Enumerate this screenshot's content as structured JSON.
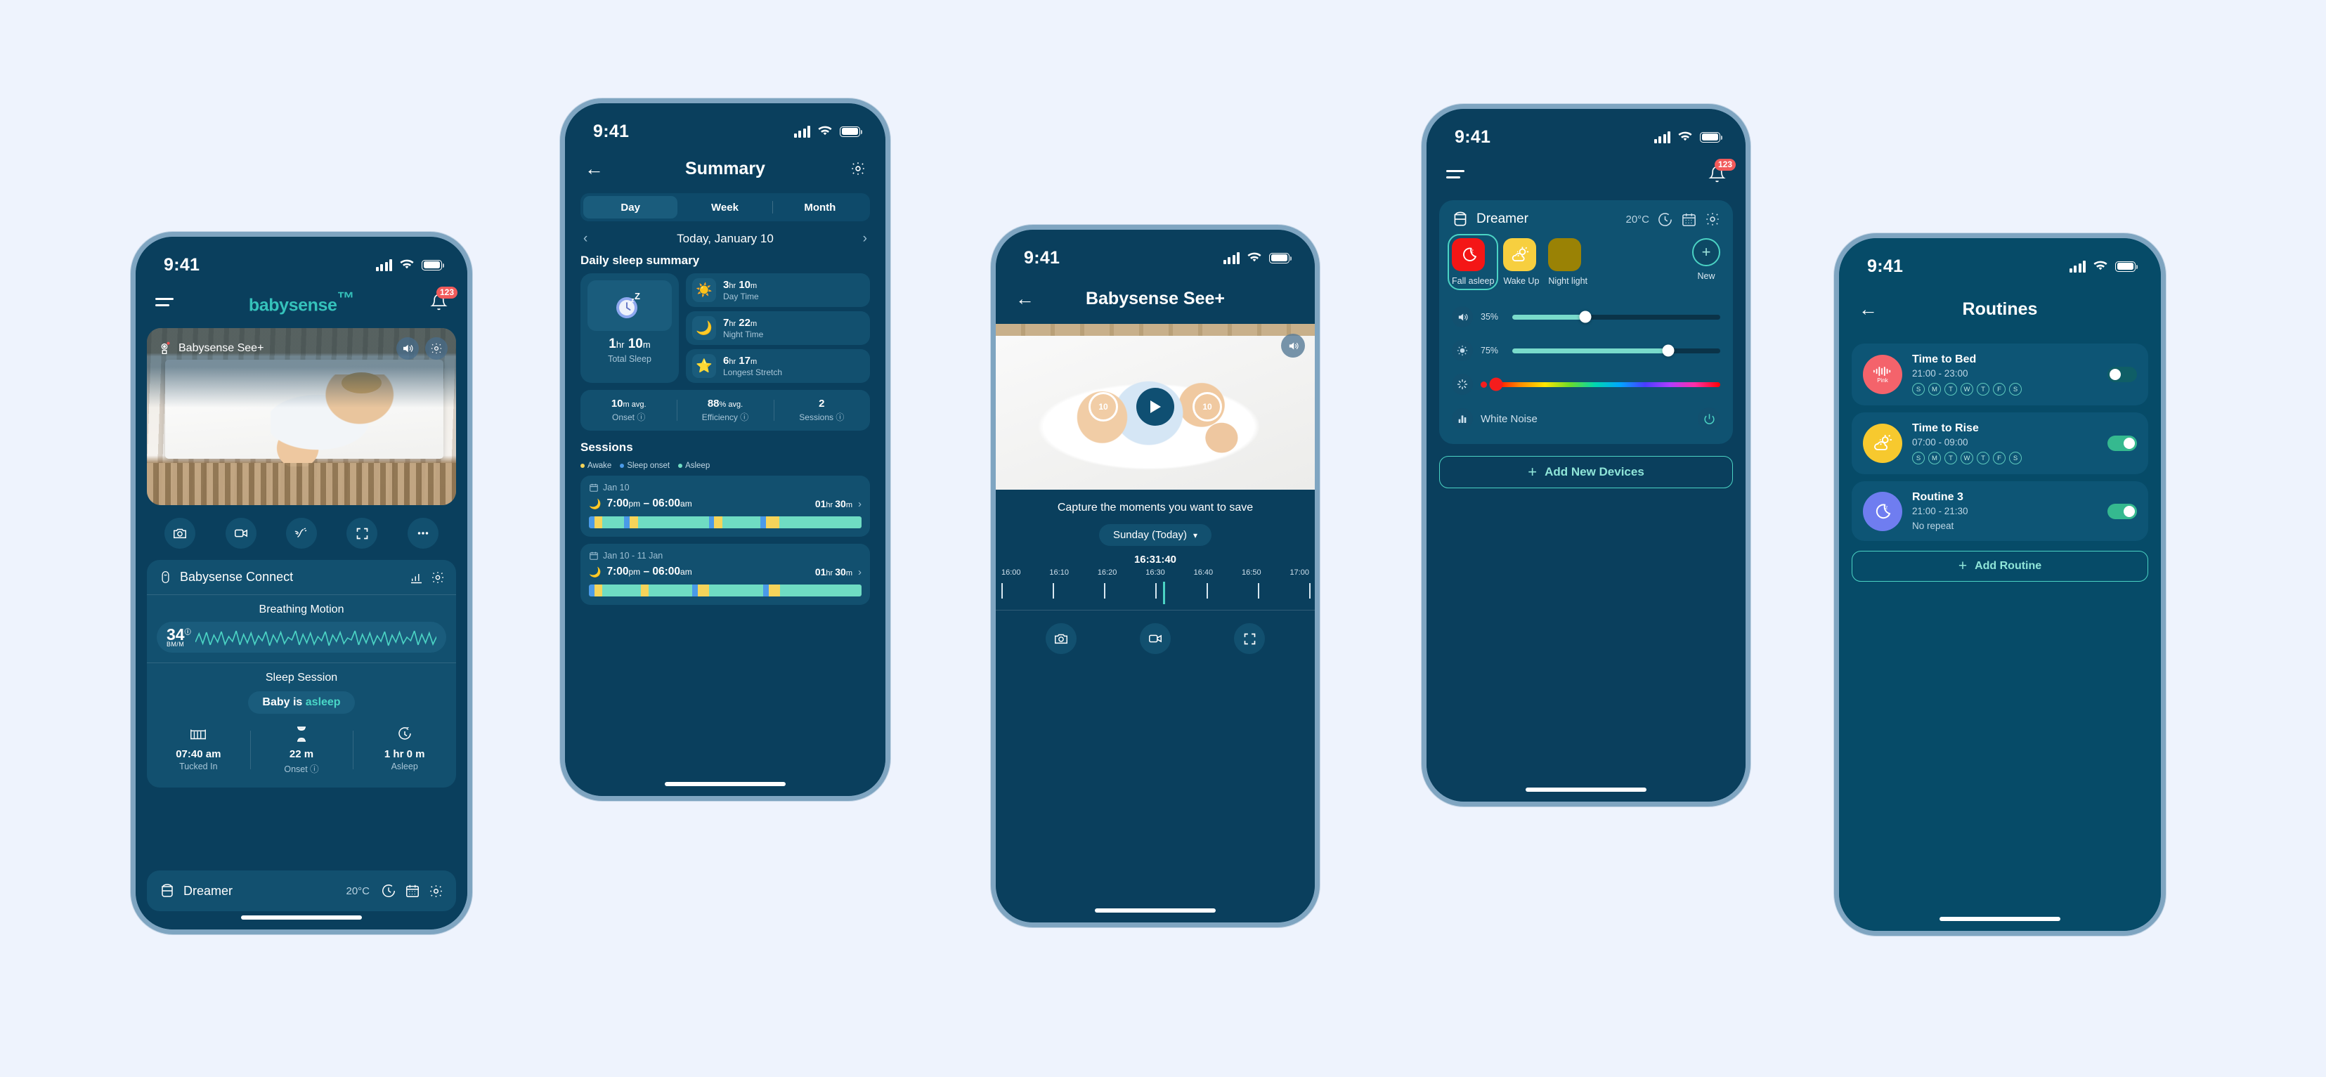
{
  "colors": {
    "page_bg": "#eef3fd",
    "phone_frame": "#7fa5c1",
    "screen_bg": "#0a3f5d",
    "card_bg": "#12506f",
    "accent_teal": "#4bd3c4",
    "brand_teal": "#35c2bb",
    "awake_yellow": "#f5d45a",
    "onset_blue": "#4a9ae8",
    "asleep_green": "#6fdcc3",
    "badge_red": "#f15b5b",
    "routines_bg": "#064b68"
  },
  "statusbar": {
    "time": "9:41",
    "signal_icon": "cellular-signal-icon",
    "wifi_icon": "wifi-icon",
    "battery_icon": "battery-icon"
  },
  "phone1": {
    "header": {
      "menu_icon": "hamburger-menu-icon",
      "brand": "babysense",
      "brand_tm": "™",
      "bell_icon": "bell-icon",
      "badge": "123"
    },
    "camera": {
      "device_name": "Babysense See+",
      "device_icon": "camera-device-icon",
      "sound_icon": "speaker-icon",
      "settings_icon": "gear-icon"
    },
    "controls": [
      {
        "name": "snapshot-button",
        "icon": "camera-icon"
      },
      {
        "name": "record-button",
        "icon": "video-camera-icon"
      },
      {
        "name": "talk-button",
        "icon": "talk-back-icon"
      },
      {
        "name": "fullscreen-button",
        "icon": "fullscreen-icon"
      },
      {
        "name": "more-button",
        "icon": "ellipsis-icon"
      }
    ],
    "connect": {
      "title": "Babysense Connect",
      "device_icon": "sensor-pad-icon",
      "stats_icon": "bar-chart-icon",
      "settings_icon": "gear-icon",
      "breathing_title": "Breathing Motion",
      "bpm_value": "34",
      "bpm_unit": "BM/M",
      "bpm_info_icon": "info-icon",
      "sleep_title": "Sleep Session",
      "status_prefix": "Baby is ",
      "status_state": "asleep",
      "stats": [
        {
          "icon": "crib-icon",
          "value": "07:40 am",
          "label": "Tucked In"
        },
        {
          "icon": "hourglass-icon",
          "value": "22 m",
          "label": "Onset ⓘ"
        },
        {
          "icon": "sleep-clock-icon",
          "value": "1 hr 0 m",
          "label": "Asleep"
        }
      ]
    },
    "dreamer": {
      "name": "Dreamer",
      "device_icon": "speaker-device-icon",
      "temperature": "20°C",
      "timer_icon": "timer-icon",
      "calendar_icon": "calendar-icon",
      "settings_icon": "gear-icon"
    }
  },
  "phone2": {
    "nav": {
      "back_icon": "back-arrow-icon",
      "title": "Summary",
      "settings_icon": "gear-icon"
    },
    "tabs": [
      {
        "label": "Day",
        "active": true
      },
      {
        "label": "Week",
        "active": false
      },
      {
        "label": "Month",
        "active": false
      }
    ],
    "date": {
      "prev_icon": "chevron-left-icon",
      "label": "Today, January 10",
      "next_icon": "chevron-right-icon"
    },
    "section_title": "Daily sleep summary",
    "total": {
      "icon": "sleep-clock-icon",
      "value": "1",
      "unit1": "hr",
      "value2": "10",
      "unit2": "m",
      "label": "Total Sleep"
    },
    "minis": [
      {
        "icon": "sun-icon",
        "v1": "3",
        "u1": "hr",
        "v2": "10",
        "u2": "m",
        "label": "Day Time"
      },
      {
        "icon": "moon-icon",
        "v1": "7",
        "u1": "hr",
        "v2": "22",
        "u2": "m",
        "label": "Night Time"
      },
      {
        "icon": "sleepy-star-icon",
        "v1": "6",
        "u1": "hr",
        "v2": "17",
        "u2": "m",
        "label": "Longest Stretch"
      }
    ],
    "averages": [
      {
        "value": "10",
        "unit": "m avg.",
        "label": "Onset ⓘ"
      },
      {
        "value": "88",
        "unit": "% avg.",
        "label": "Efficiency ⓘ"
      },
      {
        "value": "2",
        "unit": "",
        "label": "Sessions ⓘ"
      }
    ],
    "sessions_title": "Sessions",
    "legend": [
      {
        "label": "Awake",
        "color": "#f5d45a"
      },
      {
        "label": "Sleep onset",
        "color": "#4a9ae8"
      },
      {
        "label": "Asleep",
        "color": "#6fdcc3"
      }
    ],
    "sessions": [
      {
        "calendar_icon": "calendar-icon",
        "date": "Jan 10",
        "moon_icon": "moon-icon",
        "time": "7:00",
        "time_s1": "pm",
        "time2": " – 06:00",
        "time_s2": "am",
        "dur": "01",
        "dur_u1": "hr ",
        "dur2": "30",
        "dur_u2": "m",
        "chevron_icon": "chevron-right-icon"
      },
      {
        "calendar_icon": "calendar-icon",
        "date": "Jan 10 - 11 Jan",
        "moon_icon": "moon-icon",
        "time": "7:00",
        "time_s1": "pm",
        "time2": " – 06:00",
        "time_s2": "am",
        "dur": "01",
        "dur_u1": "hr ",
        "dur2": "30",
        "dur_u2": "m",
        "chevron_icon": "chevron-right-icon"
      }
    ],
    "bar_segments_1": [
      {
        "c": "#4a9ae8",
        "w": 2
      },
      {
        "c": "#f5d45a",
        "w": 3
      },
      {
        "c": "#6fdcc3",
        "w": 8
      },
      {
        "c": "#4a9ae8",
        "w": 2
      },
      {
        "c": "#f5d45a",
        "w": 3
      },
      {
        "c": "#6fdcc3",
        "w": 26
      },
      {
        "c": "#4a9ae8",
        "w": 2
      },
      {
        "c": "#f5d45a",
        "w": 3
      },
      {
        "c": "#6fdcc3",
        "w": 14
      },
      {
        "c": "#4a9ae8",
        "w": 2
      },
      {
        "c": "#f5d45a",
        "w": 5
      },
      {
        "c": "#6fdcc3",
        "w": 30
      }
    ],
    "bar_segments_2": [
      {
        "c": "#4a9ae8",
        "w": 2
      },
      {
        "c": "#f5d45a",
        "w": 3
      },
      {
        "c": "#6fdcc3",
        "w": 14
      },
      {
        "c": "#f5d45a",
        "w": 3
      },
      {
        "c": "#6fdcc3",
        "w": 16
      },
      {
        "c": "#4a9ae8",
        "w": 2
      },
      {
        "c": "#f5d45a",
        "w": 4
      },
      {
        "c": "#6fdcc3",
        "w": 20
      },
      {
        "c": "#4a9ae8",
        "w": 2
      },
      {
        "c": "#f5d45a",
        "w": 4
      },
      {
        "c": "#6fdcc3",
        "w": 30
      }
    ]
  },
  "phone3": {
    "nav": {
      "back_icon": "back-arrow-icon",
      "title": "Babysense See+"
    },
    "video": {
      "sound_icon": "speaker-icon",
      "rewind_label": "10",
      "forward_label": "10",
      "play_icon": "play-icon",
      "rewind_icon": "rewind-10-icon",
      "forward_icon": "forward-10-icon"
    },
    "caption": "Capture the moments you want to save",
    "day_selector": {
      "label": "Sunday (Today)",
      "chevron_icon": "chevron-down-icon"
    },
    "current_time": "16:31:40",
    "tick_labels": [
      "16:00",
      "16:10",
      "16:20",
      "16:30",
      "16:40",
      "16:50",
      "17:00"
    ],
    "controls": [
      {
        "name": "snapshot-button",
        "icon": "camera-icon"
      },
      {
        "name": "record-button",
        "icon": "video-camera-icon"
      },
      {
        "name": "fullscreen-button",
        "icon": "fullscreen-icon"
      }
    ]
  },
  "phone4": {
    "header": {
      "menu_icon": "hamburger-menu-icon",
      "bell_icon": "bell-icon",
      "badge": "123"
    },
    "device": {
      "name": "Dreamer",
      "device_icon": "speaker-device-icon",
      "temperature": "20°C",
      "timer_icon": "timer-icon",
      "calendar_icon": "calendar-icon",
      "settings_icon": "gear-icon"
    },
    "scenes": [
      {
        "label": "Fall asleep",
        "color": "#f41616",
        "icon": "moon-zzz-icon",
        "selected": true
      },
      {
        "label": "Wake Up",
        "color": "#f7cf3f",
        "icon": "sun-cloud-icon",
        "selected": false
      },
      {
        "label": "Night light",
        "color": "#9a8205",
        "icon": "",
        "selected": false
      }
    ],
    "new_button": {
      "label": "New",
      "icon": "plus-icon"
    },
    "sliders": [
      {
        "icon": "volume-icon",
        "value": "35%",
        "pct": 35
      },
      {
        "icon": "brightness-icon",
        "value": "75%",
        "pct": 75
      }
    ],
    "color_slider": {
      "icon": "color-wheel-icon",
      "selected_color": "#f51d1d",
      "pct": 0
    },
    "white_noise": {
      "label": "White Noise",
      "icon": "equalizer-icon",
      "power_icon": "power-icon"
    },
    "add_devices": {
      "label": "Add New Devices",
      "icon": "plus-icon"
    }
  },
  "phone5": {
    "nav": {
      "back_icon": "back-arrow-icon",
      "title": "Routines"
    },
    "routines": [
      {
        "title": "Time to Bed",
        "time": "21:00 - 23:00",
        "icon": "sound-wave-icon",
        "icon_sub": "Pink",
        "color": "#f4636b",
        "days": [
          "S",
          "M",
          "T",
          "W",
          "T",
          "F",
          "S"
        ],
        "enabled": false
      },
      {
        "title": "Time to Rise",
        "time": "07:00 - 09:00",
        "icon": "sun-cloud-icon",
        "icon_sub": "",
        "color": "#f7c92e",
        "days": [
          "S",
          "M",
          "T",
          "W",
          "T",
          "F",
          "S"
        ],
        "enabled": true
      },
      {
        "title": "Routine 3",
        "time": "21:00 - 21:30",
        "icon": "moon-zzz-icon",
        "icon_sub": "",
        "color": "#6f7df0",
        "days": [],
        "no_repeat": "No repeat",
        "enabled": true
      }
    ],
    "add_routine": {
      "label": "Add Routine",
      "icon": "plus-icon"
    }
  }
}
